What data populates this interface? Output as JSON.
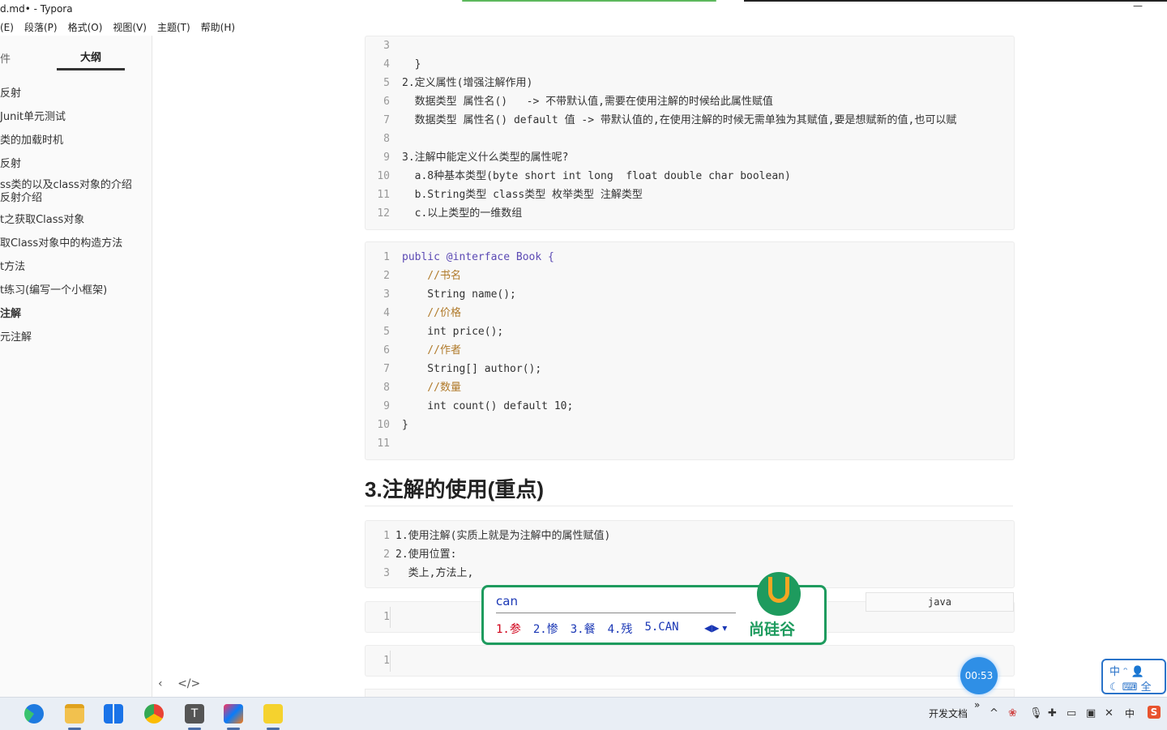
{
  "window": {
    "title": "d.md• - Typora",
    "minimize_glyph": "—"
  },
  "menu": [
    "(E)",
    "段落(P)",
    "格式(O)",
    "视图(V)",
    "主题(T)",
    "帮助(H)"
  ],
  "sidebar": {
    "tab_files": "件",
    "tab_outline": "大纲",
    "outline_items": [
      {
        "label": "反射",
        "active": false
      },
      {
        "label": "Junit单元测试",
        "active": false
      },
      {
        "label": "类的加载时机",
        "active": false
      },
      {
        "label": "反射",
        "active": false
      },
      {
        "label": "ss类的以及class对象的介绍",
        "active": false
      },
      {
        "label": "反射介绍",
        "active": false
      },
      {
        "label": "t之获取Class对象",
        "active": false
      },
      {
        "label": "取Class对象中的构造方法",
        "active": false
      },
      {
        "label": "t方法",
        "active": false
      },
      {
        "label": "t练习(编写一个小框架)",
        "active": false
      },
      {
        "label": "注解",
        "active": true
      },
      {
        "label": "元注解",
        "active": false
      }
    ],
    "bottom_prev": "‹",
    "bottom_source": "</>"
  },
  "code_block_1": {
    "lines": [
      {
        "n": "3",
        "t": ""
      },
      {
        "n": "4",
        "t": "  }"
      },
      {
        "n": "5",
        "t": "2.定义属性(增强注解作用)"
      },
      {
        "n": "6",
        "t": "  数据类型 属性名()   -> 不带默认值,需要在使用注解的时候给此属性赋值"
      },
      {
        "n": "7",
        "t": "  数据类型 属性名() default 值 -> 带默认值的,在使用注解的时候无需单独为其赋值,要是想赋新的值,也可以赋"
      },
      {
        "n": "8",
        "t": ""
      },
      {
        "n": "9",
        "t": "3.注解中能定义什么类型的属性呢?"
      },
      {
        "n": "10",
        "t": "  a.8种基本类型(byte short int long  float double char boolean)"
      },
      {
        "n": "11",
        "t": "  b.String类型 class类型 枚举类型 注解类型"
      },
      {
        "n": "12",
        "t": "  c.以上类型的一维数组"
      }
    ]
  },
  "code_block_2": {
    "lines": [
      {
        "n": "1",
        "t": "public @interface Book {"
      },
      {
        "n": "2",
        "t": "    //书名"
      },
      {
        "n": "3",
        "t": "    String name();"
      },
      {
        "n": "4",
        "t": "    //价格"
      },
      {
        "n": "5",
        "t": "    int price();"
      },
      {
        "n": "6",
        "t": "    //作者"
      },
      {
        "n": "7",
        "t": "    String[] author();"
      },
      {
        "n": "8",
        "t": "    //数量"
      },
      {
        "n": "9",
        "t": "    int count() default 10;"
      },
      {
        "n": "10",
        "t": "}"
      },
      {
        "n": "11",
        "t": ""
      }
    ]
  },
  "heading": "3.注解的使用(重点)",
  "code_block_3": {
    "lines": [
      {
        "n": "1",
        "t": "1.使用注解(实质上就是为注解中的属性赋值)"
      },
      {
        "n": "2",
        "t": "2.使用位置:"
      },
      {
        "n": "3",
        "t": "  类上,方法上,"
      }
    ]
  },
  "code_block_4": {
    "line_no": "1",
    "language": "java"
  },
  "code_block_5": {
    "line_no": "1"
  },
  "ime": {
    "input": "can",
    "candidates": [
      "1.参",
      "2.惨",
      "3.餐",
      "4.残",
      "5.CAN"
    ],
    "logo_text": "尚硅谷"
  },
  "timer": "00:53",
  "ime_status": {
    "row1": "中 ᵔ 👤",
    "row2": "☾ ⌨ 全"
  },
  "taskbar": {
    "apps": [
      "edge-icon",
      "file-explorer-icon",
      "start-icon",
      "chrome-icon",
      "typora-icon",
      "intellij-icon",
      "help-app-icon"
    ],
    "tray_text": "开发文档",
    "tray_expand": "»",
    "ime_lang": "中",
    "ime_app": "S"
  },
  "colors": {
    "accent_green": "#1e9b5e",
    "keyword": "#5c4ab4",
    "blue": "#1a37b5"
  }
}
